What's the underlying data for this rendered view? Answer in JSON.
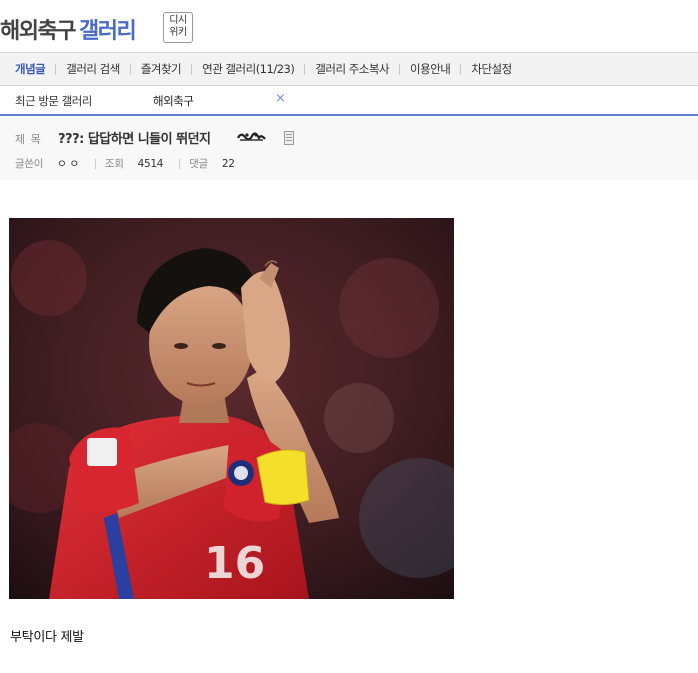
{
  "header": {
    "gallery_name_part1": "해외축구",
    "gallery_name_part2": "갤러리",
    "wiki_badge": [
      "디시",
      "위키"
    ]
  },
  "nav": {
    "items": [
      {
        "label": "개념글",
        "active": true
      },
      {
        "label": "갤러리 검색"
      },
      {
        "label": "즐겨찾기"
      },
      {
        "label": "연관 갤러리(11/23)"
      },
      {
        "label": "갤러리 주소복사"
      },
      {
        "label": "이용안내"
      },
      {
        "label": "차단설정"
      }
    ]
  },
  "recent": {
    "label": "최근 방문 갤러리",
    "gallery": "해외축구",
    "close_icon": "×"
  },
  "post": {
    "title_label": "제 목",
    "title": "???: 답답하면 니들이 뛰던지",
    "author_label": "글쓴이",
    "author": "ㅇ ㅇ",
    "views_label": "조회",
    "views": "4514",
    "comments_label": "댓글",
    "comments": "22",
    "body_text": "부탁이다 제발",
    "image_subject": "player-applauding-photo"
  },
  "colors": {
    "accent": "#4b6bc9",
    "nav_bg": "#f3f3f3",
    "post_head_bg": "#f8f8f8",
    "recent_border": "#5f82d0"
  }
}
